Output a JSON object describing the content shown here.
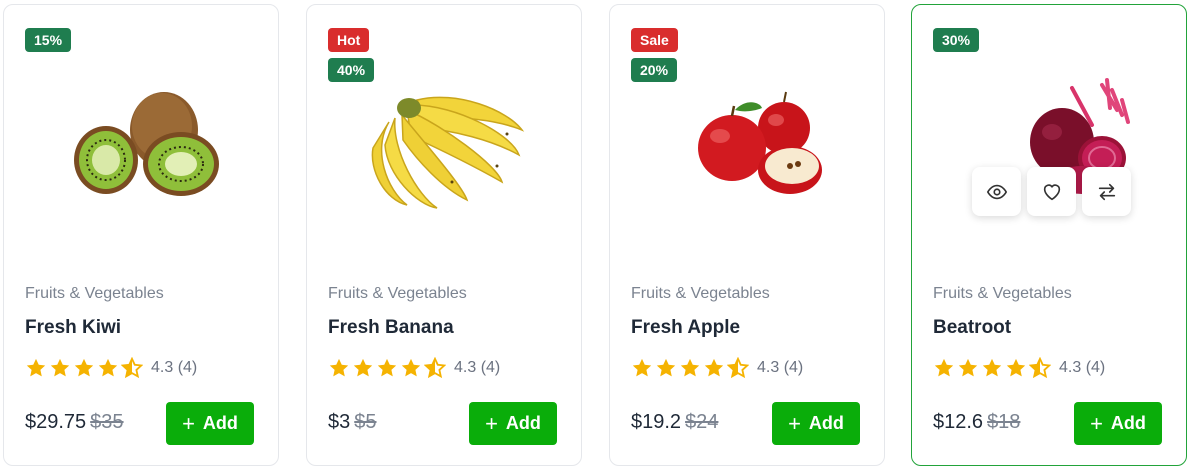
{
  "products": [
    {
      "badges": [
        {
          "label": "15%",
          "kind": "discount"
        }
      ],
      "category": "Fruits & Vegetables",
      "name": "Fresh Kiwi",
      "rating_text": "4.3 (4)",
      "rating": 4.3,
      "price": "$29.75",
      "old_price": "$35",
      "add_label": "Add",
      "image": "kiwi"
    },
    {
      "badges": [
        {
          "label": "Hot",
          "kind": "sale"
        },
        {
          "label": "40%",
          "kind": "discount"
        }
      ],
      "category": "Fruits & Vegetables",
      "name": "Fresh Banana",
      "rating_text": "4.3 (4)",
      "rating": 4.3,
      "price": "$3",
      "old_price": "$5",
      "add_label": "Add",
      "image": "banana"
    },
    {
      "badges": [
        {
          "label": "Sale",
          "kind": "sale"
        },
        {
          "label": "20%",
          "kind": "discount"
        }
      ],
      "category": "Fruits & Vegetables",
      "name": "Fresh Apple",
      "rating_text": "4.3 (4)",
      "rating": 4.3,
      "price": "$19.2",
      "old_price": "$24",
      "add_label": "Add",
      "image": "apple"
    },
    {
      "badges": [
        {
          "label": "30%",
          "kind": "discount"
        }
      ],
      "category": "Fruits & Vegetables",
      "name": "Beatroot",
      "rating_text": "4.3 (4)",
      "rating": 4.3,
      "price": "$12.6",
      "old_price": "$18",
      "add_label": "Add",
      "image": "beetroot",
      "hover_actions": [
        "eye-icon",
        "heart-icon",
        "compare-icon"
      ]
    }
  ],
  "colors": {
    "accent": "#0aad0a",
    "discount_badge": "#1f7d4f",
    "sale_badge": "#d92d2d",
    "star": "#f5b301",
    "active_border": "#22a33a"
  }
}
